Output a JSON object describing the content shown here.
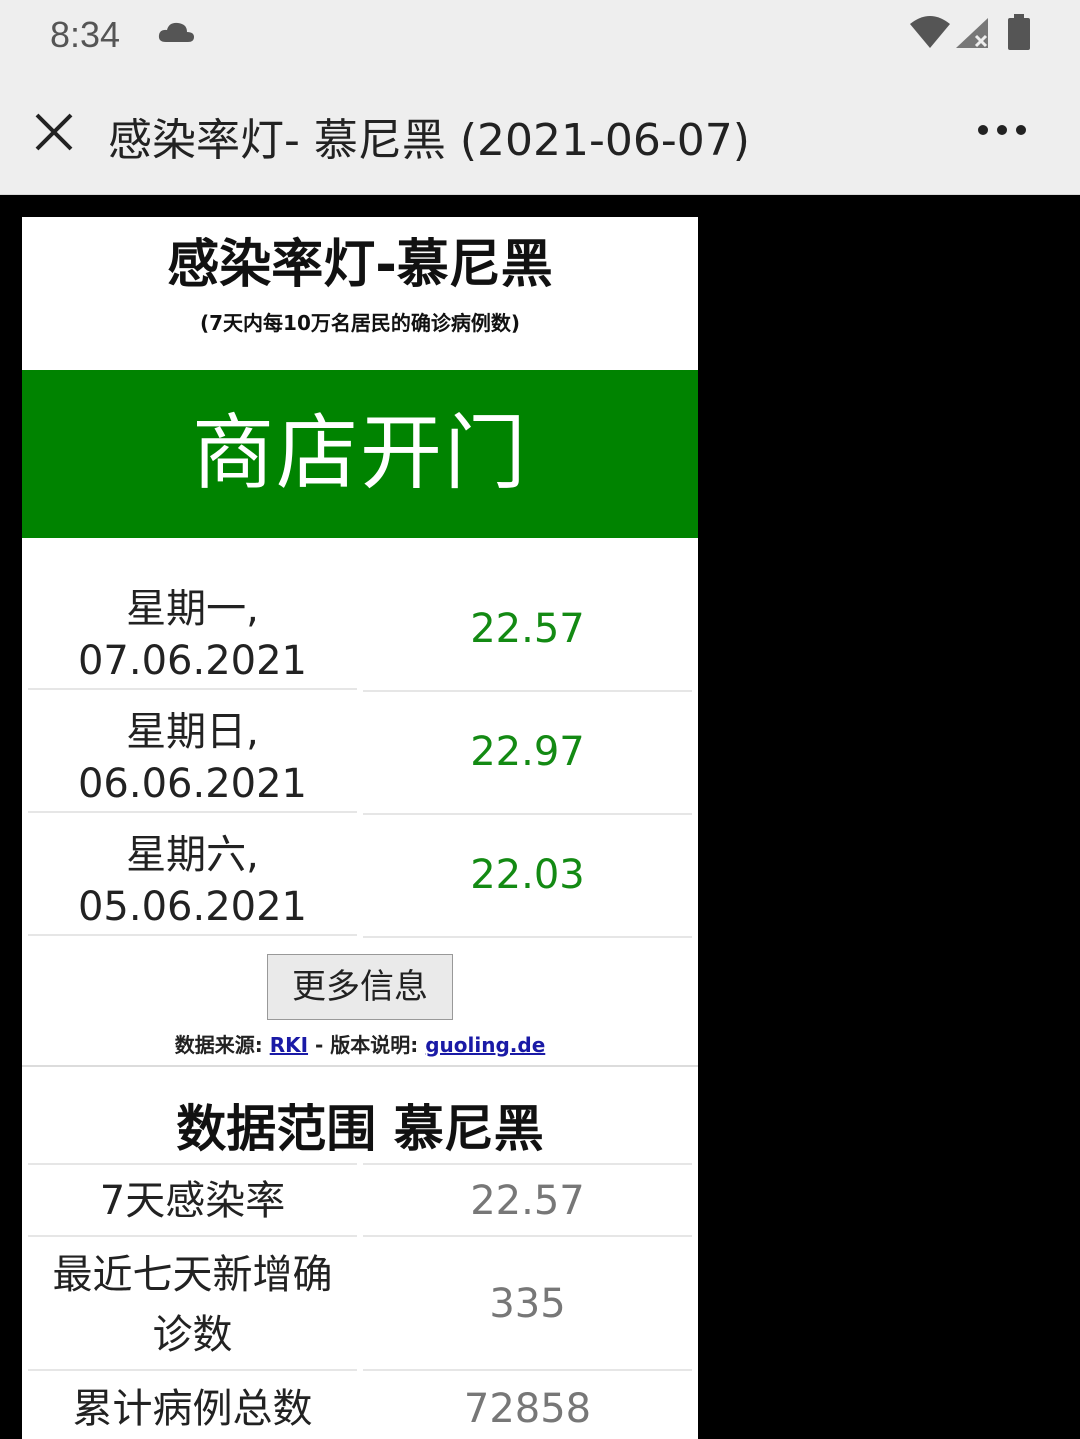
{
  "statusbar": {
    "time": "8:34",
    "icons": [
      "cloud-icon",
      "wifi-icon",
      "signal-icon",
      "battery-icon"
    ]
  },
  "titlebar": {
    "title": "感染率灯- 慕尼黑 (2021-06-07)",
    "close_icon": "close-icon",
    "more_icon": "more-options-icon"
  },
  "card": {
    "title": "感染率灯-慕尼黑",
    "subtitle": "(7天内每10万名居民的确诊病例数)",
    "status": "商店开门",
    "status_color": "#008300",
    "value_color": "#138a13",
    "daily": [
      {
        "day": "星期一,",
        "date": "07.06.2021",
        "value": "22.57"
      },
      {
        "day": "星期日,",
        "date": "06.06.2021",
        "value": "22.97"
      },
      {
        "day": "星期六,",
        "date": "05.06.2021",
        "value": "22.03"
      }
    ],
    "more_button": "更多信息",
    "source": {
      "prefix": "数据来源: ",
      "rki_link": "RKI",
      "middle": " - 版本说明: ",
      "site_link": "guoling.de"
    }
  },
  "range": {
    "title": "数据范围 慕尼黑",
    "rows": [
      {
        "label": "7天感染率",
        "value": "22.57"
      },
      {
        "label_line1": "最近七天新增确",
        "label_line2": "诊数",
        "value": "335"
      },
      {
        "label": "累计病例总数",
        "value": "72858"
      }
    ]
  }
}
